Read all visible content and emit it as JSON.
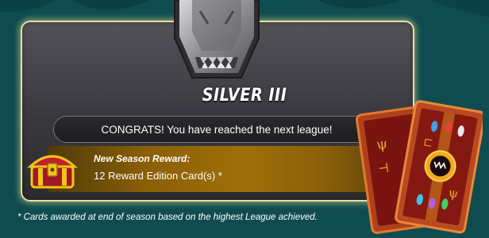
{
  "league": {
    "name": "SILVER III",
    "badge_icon": "silver-league-badge-icon"
  },
  "congrats": {
    "text": "CONGRATS! You have reached the next league!"
  },
  "reward": {
    "title": "New Season Reward:",
    "description": "12 Reward Edition Card(s) *",
    "chest_icon": "treasure-chest-icon",
    "cards_icon": "reward-cards-icon"
  },
  "footnote": "* Cards awarded at end of season based on the highest League achieved.",
  "colors": {
    "background": "#0f4c4f",
    "panel_border": "#e9df9c",
    "reward_gold": "#a06f09",
    "card_red": "#8e1d14"
  }
}
